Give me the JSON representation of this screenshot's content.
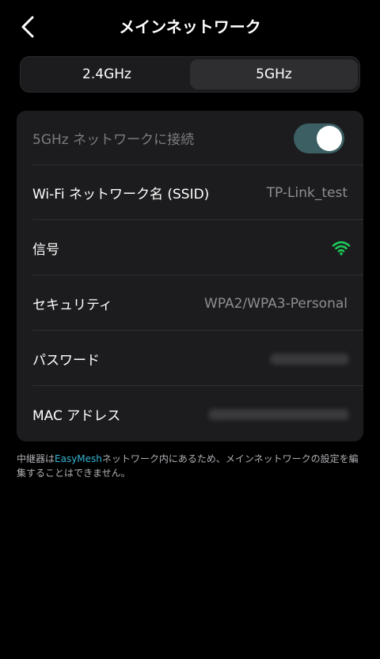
{
  "header": {
    "title": "メインネットワーク",
    "back_icon": "chevron-left-icon"
  },
  "bands": {
    "tabs": [
      {
        "label": "2.4GHz",
        "active": false
      },
      {
        "label": "5GHz",
        "active": true
      }
    ]
  },
  "settings": {
    "enable": {
      "label": "5GHz ネットワークに接続",
      "toggle_on": true
    },
    "ssid": {
      "label": "Wi-Fi ネットワーク名 (SSID)",
      "value": "TP-Link_test"
    },
    "signal": {
      "label": "信号",
      "icon": "wifi-icon",
      "color": "#1ec85a"
    },
    "security": {
      "label": "セキュリティ",
      "value": "WPA2/WPA3-Personal"
    },
    "password": {
      "label": "パスワード"
    },
    "mac": {
      "label": "MAC アドレス"
    }
  },
  "note": {
    "prefix": "中継器は",
    "link": "EasyMesh",
    "suffix": "ネットワーク内にあるため、メインネットワークの設定を編集することはできません。"
  },
  "colors": {
    "accent_link": "#37b6d6",
    "toggle_track": "#3b5f63",
    "signal_green": "#1ec85a"
  }
}
